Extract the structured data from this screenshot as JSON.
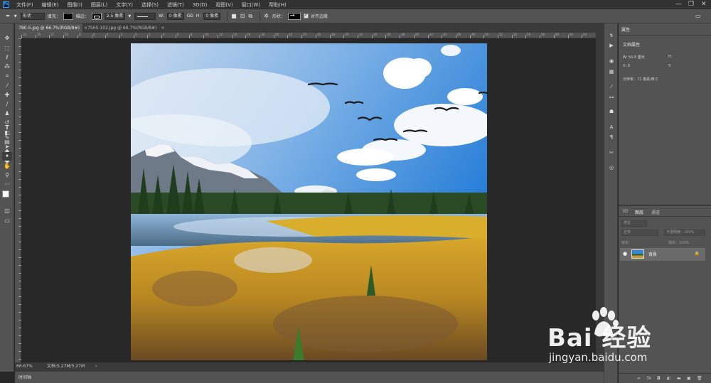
{
  "menubar": {
    "app_icon": "Ps",
    "items": [
      "文件(F)",
      "编辑(E)",
      "图像(I)",
      "图层(L)",
      "文字(Y)",
      "选择(S)",
      "滤镜(T)",
      "3D(D)",
      "视图(V)",
      "窗口(W)",
      "帮助(H)"
    ],
    "window_controls": [
      "—",
      "❐",
      "✕"
    ]
  },
  "options": {
    "shape_mode": "形状",
    "fill_label": "填充：",
    "stroke_label": "描边：",
    "stroke_width": "2.5 像素",
    "w_label": "W:",
    "w_value": "0 像素",
    "link_icon": "GĐ",
    "h_label": "H:",
    "h_value": "0 像素",
    "shape_label": "形状：",
    "align_edges_label": "对齐边缘"
  },
  "tabs": [
    {
      "label": "780-5.jpg @ 66.7%(RGB/8#)",
      "close": "×",
      "active": true
    },
    {
      "label": "7505-102.jpg @ 66.7%(RGB/8#)",
      "close": "×",
      "active": false
    }
  ],
  "status": {
    "zoom": "66.67%",
    "doc_info": "文档:5.27M/5.27M",
    "arrow": "›"
  },
  "timeline": {
    "label": "时间轴"
  },
  "properties": {
    "tab": "属性",
    "section": "文档属性",
    "w": "W:  50.8 厘米",
    "h": "H:",
    "x": "X:  0",
    "y": "Y:",
    "resolution": "分辨率：72 像素/英寸"
  },
  "layers": {
    "tabs": [
      "3D",
      "图层",
      "通道"
    ],
    "kind_placeholder": "类型",
    "blend_mode": "正常",
    "opacity": "不透明度：100%",
    "lock_label": "锁定：",
    "fill": "填充：100%",
    "layer_name": "背景"
  },
  "watermark": {
    "brand": "Bai  经验",
    "url": "jingyan.baidu.com"
  },
  "rulers": {
    "top_numbers": [
      "14",
      "16",
      "12",
      "10",
      "8",
      "6",
      "4",
      "2",
      "0",
      "2",
      "4",
      "6",
      "8",
      "10",
      "12",
      "14",
      "16",
      "18",
      "20",
      "22",
      "24",
      "26",
      "28",
      "30",
      "32",
      "34",
      "36",
      "38",
      "40",
      "42",
      "44",
      "46",
      "48",
      "50",
      "52",
      "54",
      "56",
      "58",
      "60",
      "62",
      "64"
    ]
  },
  "colors": {
    "panel": "#535353",
    "dark": "#282828",
    "accent": "#2fa3ff"
  }
}
